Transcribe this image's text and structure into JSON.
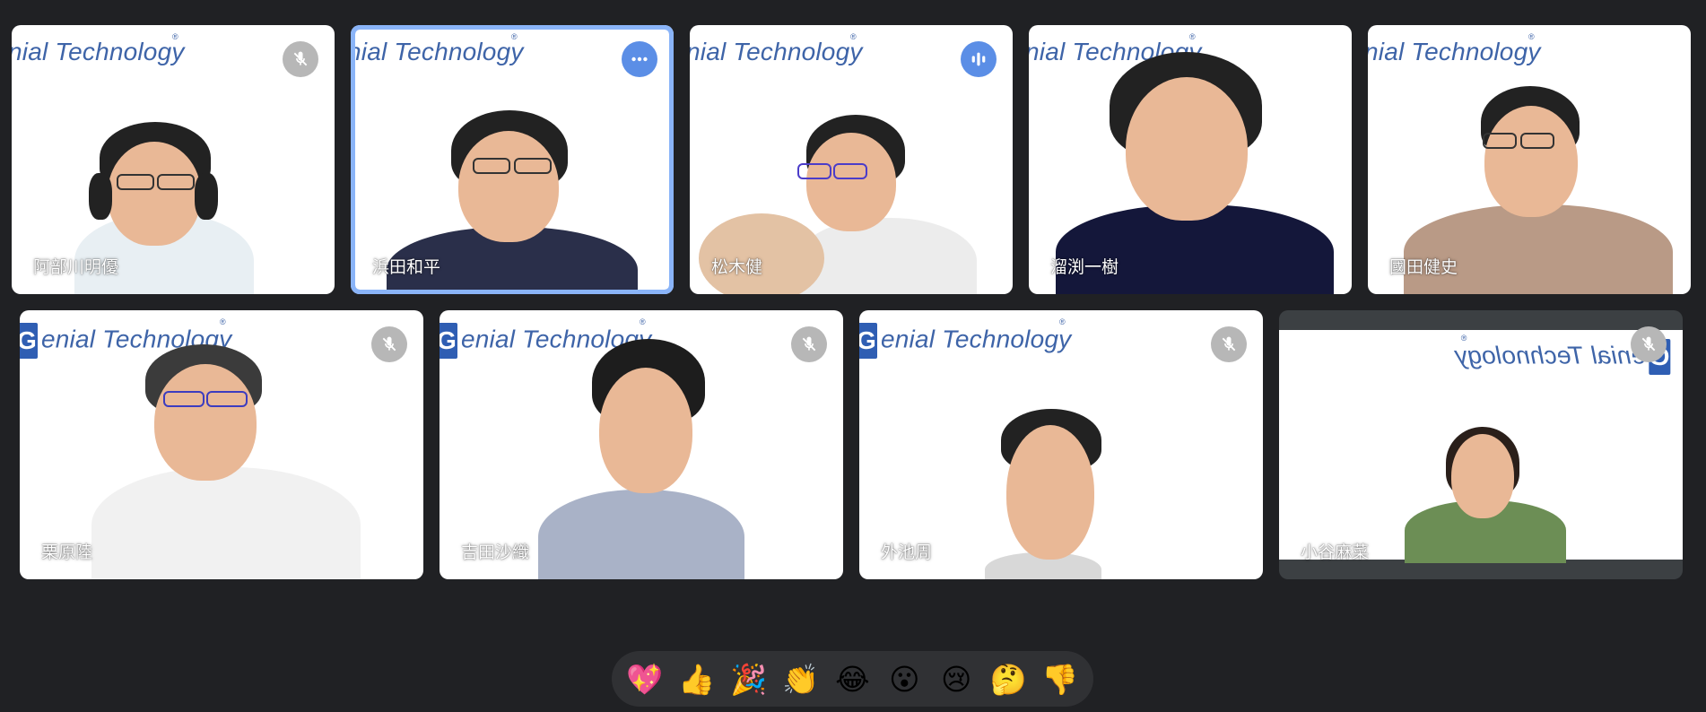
{
  "brand_text": "nial Technology",
  "brand_text_full": "enial Technology",
  "brand_mark": "G",
  "brand_reg": "®",
  "colors": {
    "background": "#202124",
    "active_border": "#8ab4f8",
    "brand_blue": "#3e64a8",
    "muted_button": "#b7b7b7",
    "active_button": "#5b8ee6",
    "reaction_bar": "#303134"
  },
  "participants": [
    {
      "name": "阿部川明優",
      "status": "muted",
      "icon": "mic-off-icon"
    },
    {
      "name": "浜田和平",
      "status": "active-speaker",
      "icon": "more-options-icon"
    },
    {
      "name": "松木健",
      "status": "speaking",
      "icon": "audio-level-icon"
    },
    {
      "name": "溜渕一樹",
      "status": "none",
      "icon": ""
    },
    {
      "name": "國田健史",
      "status": "none",
      "icon": ""
    },
    {
      "name": "栗原陸",
      "status": "muted",
      "icon": "mic-off-icon"
    },
    {
      "name": "吉田沙織",
      "status": "muted",
      "icon": "mic-off-icon"
    },
    {
      "name": "外池周",
      "status": "muted",
      "icon": "mic-off-icon"
    },
    {
      "name": "小谷麻菜",
      "status": "muted",
      "icon": "mic-off-icon"
    }
  ],
  "reactions": [
    {
      "name": "sparkling-heart",
      "glyph": "💖"
    },
    {
      "name": "thumbs-up",
      "glyph": "👍"
    },
    {
      "name": "party-popper",
      "glyph": "🎉"
    },
    {
      "name": "clapping-hands",
      "glyph": "👏"
    },
    {
      "name": "tears-of-joy",
      "glyph": "😂"
    },
    {
      "name": "surprised",
      "glyph": "😮"
    },
    {
      "name": "crying",
      "glyph": "😢"
    },
    {
      "name": "thinking",
      "glyph": "🤔"
    },
    {
      "name": "thumbs-down",
      "glyph": "👎"
    }
  ]
}
